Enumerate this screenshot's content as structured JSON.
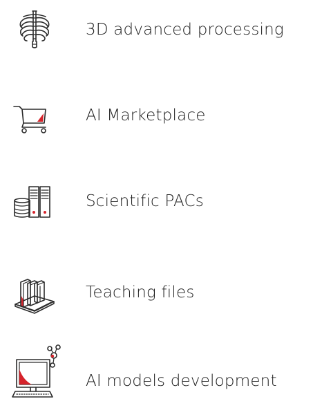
{
  "features": [
    {
      "label": "3D advanced processing",
      "icon": "ribcage-icon"
    },
    {
      "label": "AI Marketplace",
      "icon": "shopping-cart-icon"
    },
    {
      "label": "Scientific PACs",
      "icon": "server-database-icon"
    },
    {
      "label": "Teaching files",
      "icon": "books-icon"
    },
    {
      "label": "AI models development",
      "icon": "computer-network-icon"
    }
  ],
  "colors": {
    "accent": "#d6232b",
    "icon_stroke": "#2b2b2b",
    "text": "#1c1c1c",
    "background": "#ffffff"
  }
}
